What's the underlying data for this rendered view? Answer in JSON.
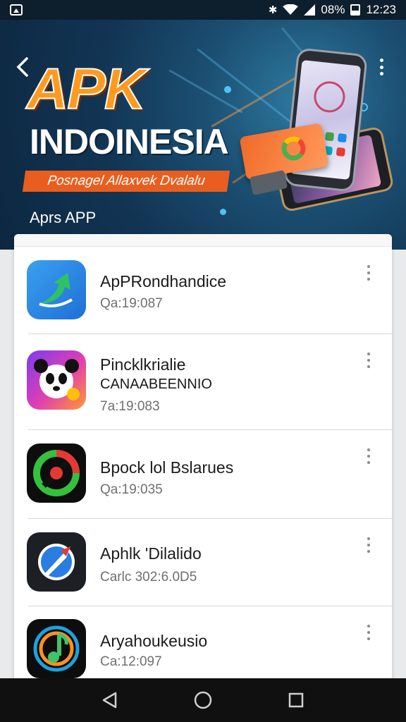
{
  "status_bar": {
    "battery": "08%",
    "time": "12:23",
    "icons": [
      "gallery-icon",
      "bluetooth-icon",
      "wifi-icon",
      "signal-icon",
      "battery-icon"
    ]
  },
  "hero": {
    "title": "APK",
    "subtitle": "INDOINESIA",
    "ribbon": "Posnagel Allaxvek Dvalalu",
    "caption": "Aprs APP"
  },
  "apps": [
    {
      "title": "ApPRondhandice",
      "subtitle": "",
      "meta": "Qa:19:087",
      "icon": "green-arrow-icon"
    },
    {
      "title": "Pincklkrialie",
      "subtitle": "CANAABEENNIO",
      "meta": "7a:19:083",
      "icon": "panda-icon"
    },
    {
      "title": "Bpock lol Bslarues",
      "subtitle": "",
      "meta": "Qa:19:035",
      "icon": "target-icon"
    },
    {
      "title": "Aphlk 'Dilalido",
      "subtitle": "",
      "meta": "Carlc 302:6.0D5",
      "icon": "rocket-icon"
    },
    {
      "title": "Aryahoukeusio",
      "subtitle": "",
      "meta": "Ca:12:097",
      "icon": "music-note-icon"
    }
  ],
  "colors": {
    "accent_orange": "#ff9a20",
    "ribbon": "#e95e1f",
    "hero_bg": "#123554"
  }
}
